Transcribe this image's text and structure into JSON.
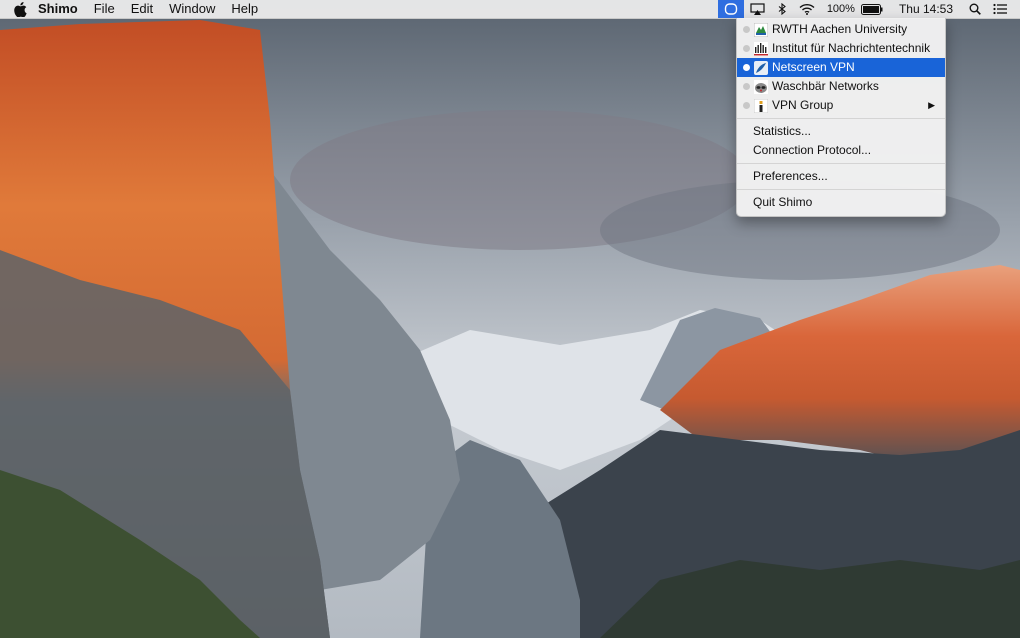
{
  "menubar": {
    "app_name": "Shimo",
    "menus": [
      "File",
      "Edit",
      "Window",
      "Help"
    ],
    "battery_percent": "100%",
    "clock": "Thu 14:53"
  },
  "status_icons": [
    "shimo-icon",
    "airplay-icon",
    "bluetooth-icon",
    "wifi-icon",
    "battery-icon",
    "spotlight-icon",
    "notification-center-icon"
  ],
  "shimo_menu": {
    "connections": [
      {
        "label": "RWTH Aachen University",
        "icon": "rwth-logo-icon",
        "selected": false
      },
      {
        "label": "Institut für Nachrichtentechnik",
        "icon": "institute-logo-icon",
        "selected": false
      },
      {
        "label": "Netscreen VPN",
        "icon": "netscreen-icon",
        "selected": true
      },
      {
        "label": "Waschbär Networks",
        "icon": "raccoon-icon",
        "selected": false
      },
      {
        "label": "VPN Group",
        "icon": "vpn-group-icon",
        "selected": false,
        "submenu": true
      }
    ],
    "actions": [
      "Statistics...",
      "Connection Protocol..."
    ],
    "preferences": "Preferences...",
    "quit": "Quit Shimo"
  },
  "colors": {
    "highlight": "#1964d8",
    "menubar": "#ececec"
  }
}
